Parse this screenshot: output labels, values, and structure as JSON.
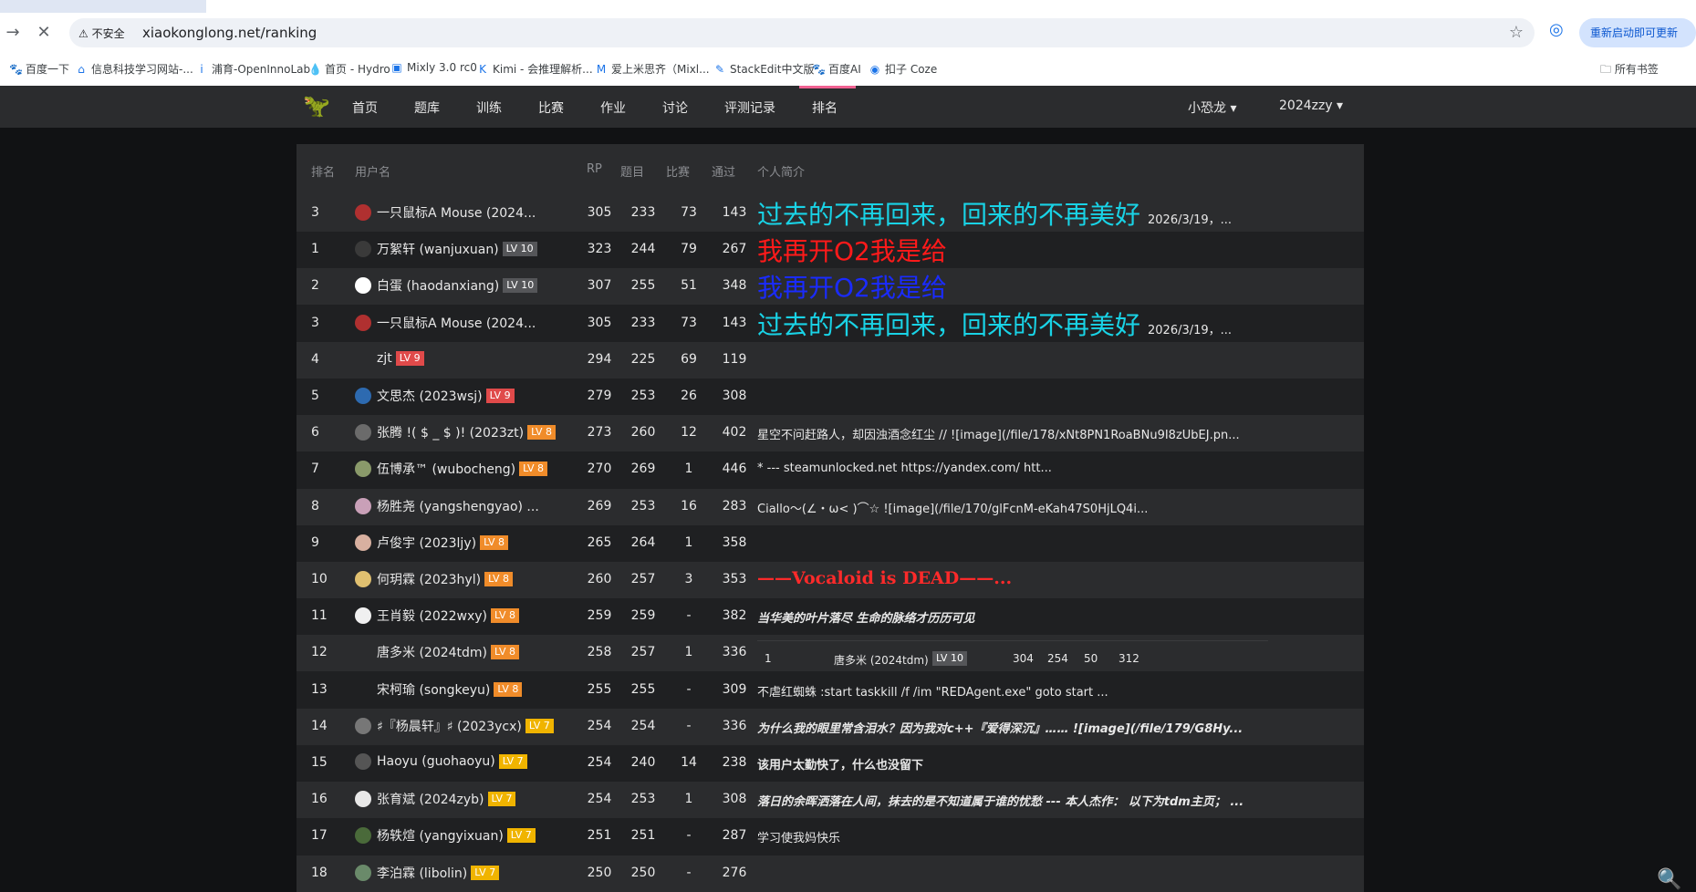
{
  "browser": {
    "insecure_label": "不安全",
    "url": "xiaokonglong.net/ranking",
    "update_button": "重新启动即可更新",
    "bookmarks": [
      {
        "label": "百度一下",
        "icon": "paw-icon"
      },
      {
        "label": "信息科技学习网站-...",
        "icon": "home-icon"
      },
      {
        "label": "浦育-OpenInnoLab",
        "icon": "info-icon"
      },
      {
        "label": "首页 - Hydro",
        "icon": "drop-icon"
      },
      {
        "label": "Mixly 3.0 rc0",
        "icon": "mixly-icon"
      },
      {
        "label": "Kimi - 会推理解析...",
        "icon": "kimi-icon"
      },
      {
        "label": "爱上米思齐（Mixl...",
        "icon": "m-icon"
      },
      {
        "label": "StackEdit中文版",
        "icon": "stackedit-icon"
      },
      {
        "label": "百度AI",
        "icon": "paw-icon"
      },
      {
        "label": "扣子 Coze",
        "icon": "coze-icon"
      }
    ],
    "all_bookmarks": "所有书签"
  },
  "nav": {
    "items": [
      "首页",
      "题库",
      "训练",
      "比赛",
      "作业",
      "讨论",
      "评测记录",
      "排名"
    ],
    "active": "排名",
    "user1": "小恐龙",
    "user2": "2024zzy"
  },
  "table": {
    "headers": {
      "rank": "排名",
      "user": "用户名",
      "rp": "RP",
      "problems": "题目",
      "contests": "比赛",
      "passed": "通过",
      "bio": "个人简介"
    },
    "rows": [
      {
        "rank": "3",
        "user": "一只鼠标A Mouse (2024...",
        "lv": "",
        "rp": "305",
        "problems": "233",
        "contests": "73",
        "passed": "143",
        "bio": "过去的不再回来，回来的不再美好",
        "bio_date": "2026/3/19，...",
        "bio_style": "big-cyan",
        "avatar": "#b03030"
      },
      {
        "rank": "1",
        "user": "万絮轩 (wanjuxuan)",
        "lv": "LV 10",
        "rp": "323",
        "problems": "244",
        "contests": "79",
        "passed": "267",
        "bio": "我再开O2我是给",
        "bio_date": "",
        "bio_style": "big-red",
        "avatar": "#3a3a3a"
      },
      {
        "rank": "2",
        "user": "白蛋 (haodanxiang)",
        "lv": "LV 10",
        "rp": "307",
        "problems": "255",
        "contests": "51",
        "passed": "348",
        "bio": "我再开O2我是给",
        "bio_date": "",
        "bio_style": "big-blue",
        "avatar": "#ffffff"
      },
      {
        "rank": "3",
        "user": "一只鼠标A Mouse (2024...",
        "lv": "",
        "rp": "305",
        "problems": "233",
        "contests": "73",
        "passed": "143",
        "bio": "过去的不再回来，回来的不再美好",
        "bio_date": "2026/3/19，...",
        "bio_style": "big-cyan",
        "avatar": "#b03030"
      },
      {
        "rank": "4",
        "user": "zjt",
        "lv": "LV 9",
        "rp": "294",
        "problems": "225",
        "contests": "69",
        "passed": "119",
        "bio": "",
        "bio_date": "",
        "bio_style": "normal",
        "avatar": ""
      },
      {
        "rank": "5",
        "user": "文思杰 (2023wsj)",
        "lv": "LV 9",
        "rp": "279",
        "problems": "253",
        "contests": "26",
        "passed": "308",
        "bio": "",
        "bio_date": "",
        "bio_style": "normal",
        "avatar": "#2d6ab0"
      },
      {
        "rank": "6",
        "user": "张腾 !( $ _ $ )! (2023zt)",
        "lv": "LV 8",
        "rp": "273",
        "problems": "260",
        "contests": "12",
        "passed": "402",
        "bio": "星空不问赶路人，却因浊酒念红尘 // ![image](/file/178/xNt8PN1RoaBNu9I8zUbEJ.pn...",
        "bio_date": "",
        "bio_style": "normal",
        "avatar": "#6b6b6b"
      },
      {
        "rank": "7",
        "user": "伍博承™ (wubocheng)",
        "lv": "LV 8",
        "rp": "270",
        "problems": "269",
        "contests": "1",
        "passed": "446",
        "bio": "* --- steamunlocked.net https://yandex.com/ htt...",
        "bio_date": "",
        "bio_style": "normal",
        "avatar": "#8a9a6a"
      },
      {
        "rank": "8",
        "user": "杨胜尧 (yangshengyao) ...",
        "lv": "",
        "rp": "269",
        "problems": "253",
        "contests": "16",
        "passed": "283",
        "bio": "Ciallo～(∠・ω< )⌒☆ ![image](/file/170/glFcnM-eKah47S0HjLQ4i...",
        "bio_date": "",
        "bio_style": "normal",
        "avatar": "#c9a0b8"
      },
      {
        "rank": "9",
        "user": "卢俊宇 (2023ljy)",
        "lv": "LV 8",
        "rp": "265",
        "problems": "264",
        "contests": "1",
        "passed": "358",
        "bio": "",
        "bio_date": "",
        "bio_style": "normal",
        "avatar": "#d8b0a0"
      },
      {
        "rank": "10",
        "user": "何玥霖 (2023hyl)",
        "lv": "LV 8",
        "rp": "260",
        "problems": "257",
        "contests": "3",
        "passed": "353",
        "bio": "——Vocaloid is DEAD——...",
        "bio_date": "",
        "bio_style": "mono-red",
        "avatar": "#e0c070"
      },
      {
        "rank": "11",
        "user": "王肖毅 (2022wxy)",
        "lv": "LV 8",
        "rp": "259",
        "problems": "259",
        "contests": "-",
        "passed": "382",
        "bio": "当华美的叶片落尽 生命的脉络才历历可见",
        "bio_date": "",
        "bio_style": "italic",
        "avatar": "#f0f0f0"
      },
      {
        "rank": "12",
        "user": "唐多米 (2024tdm)",
        "lv": "LV 8",
        "rp": "258",
        "problems": "257",
        "contests": "1",
        "passed": "336",
        "bio": "",
        "bio_date": "",
        "bio_style": "inner",
        "avatar": "",
        "inner": {
          "rank": "1",
          "user": "唐多米 (2024tdm)",
          "lv": "LV 10",
          "rp": "304",
          "problems": "254",
          "contests": "50",
          "passed": "312"
        }
      },
      {
        "rank": "13",
        "user": "宋柯瑜 (songkeyu)",
        "lv": "LV 8",
        "rp": "255",
        "problems": "255",
        "contests": "-",
        "passed": "309",
        "bio": "不虐红蜘蛛 :start taskkill /f /im \"REDAgent.exe\" goto start ...",
        "bio_date": "",
        "bio_style": "normal",
        "avatar": ""
      },
      {
        "rank": "14",
        "user": "♯『杨晨轩』♯ (2023ycx)",
        "lv": "LV 7",
        "rp": "254",
        "problems": "254",
        "contests": "-",
        "passed": "336",
        "bio": "为什么我的眼里常含泪水？因为我对c++『爱得深沉』…… ![image](/file/179/G8Hy...",
        "bio_date": "",
        "bio_style": "italic",
        "avatar": "#777777"
      },
      {
        "rank": "15",
        "user": "Haoyu (guohaoyu)",
        "lv": "LV 7",
        "rp": "254",
        "problems": "240",
        "contests": "14",
        "passed": "238",
        "bio": "该用户太勤快了，什么也没留下",
        "bio_date": "",
        "bio_style": "bold",
        "avatar": "#555555"
      },
      {
        "rank": "16",
        "user": "张育斌 (2024zyb)",
        "lv": "LV 7",
        "rp": "254",
        "problems": "253",
        "contests": "1",
        "passed": "308",
        "bio": "落日的余晖洒落在人间，抹去的是不知道属于谁的忧愁 --- 本人杰作： 以下为tdm主页； ...",
        "bio_date": "",
        "bio_style": "italic",
        "avatar": "#e8e8e8"
      },
      {
        "rank": "17",
        "user": "杨轶煊 (yangyixuan)",
        "lv": "LV 7",
        "rp": "251",
        "problems": "251",
        "contests": "-",
        "passed": "287",
        "bio": "学习使我妈快乐",
        "bio_date": "",
        "bio_style": "normal",
        "avatar": "#4a6a3a"
      },
      {
        "rank": "18",
        "user": "李泊霖 (libolin)",
        "lv": "LV 7",
        "rp": "250",
        "problems": "250",
        "contests": "-",
        "passed": "276",
        "bio": "",
        "bio_date": "",
        "bio_style": "normal",
        "avatar": "#6a8a6a"
      }
    ]
  },
  "colors": {
    "lv10": "#555659",
    "lv9": "#e04a4a",
    "lv8": "#f08c2a",
    "lv7": "#f0b400",
    "cyan": "#19d3e6",
    "red": "#ff1a1a",
    "blue": "#1a2bff",
    "vocaloid": "#ff2a2a"
  }
}
